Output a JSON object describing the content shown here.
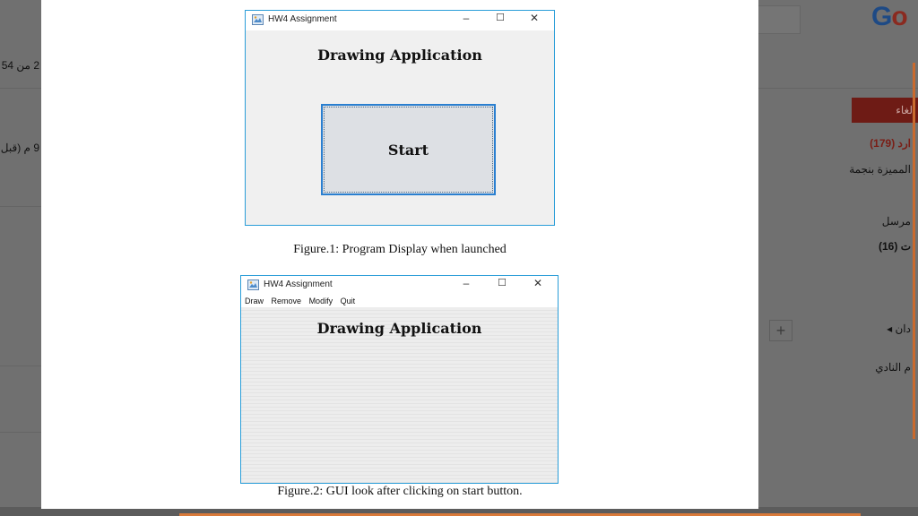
{
  "figure1": {
    "window_title": "HW4 Assignment",
    "controls": {
      "minimize": "–",
      "maximize": "☐",
      "close": "✕"
    },
    "app_title": "Drawing Application",
    "start_button": "Start",
    "caption": "Figure.1: Program Display when launched"
  },
  "figure2": {
    "window_title": "HW4 Assignment",
    "controls": {
      "minimize": "–",
      "maximize": "☐",
      "close": "✕"
    },
    "menu": [
      "Draw",
      "Remove",
      "Modify",
      "Quit"
    ],
    "app_title": "Drawing Application",
    "caption": "Figure.2: GUI look after clicking on start button."
  },
  "background_left": {
    "line1": "2 من 54",
    "line2": "9 م (قبل"
  },
  "background_right": {
    "logo_g": "G",
    "logo_o": "o",
    "red_button": "لغاء",
    "count_link": "ارد (179)",
    "starred": "المميزة بنجمة",
    "sent": "مرسل",
    "drafts": "ت (16)",
    "labels": "دان ◂",
    "plus": "+",
    "club": "م النادي"
  },
  "colors": {
    "window_border": "#2a9dd8",
    "button_border": "#2a7fd0",
    "button_fill": "#dde0e4"
  }
}
